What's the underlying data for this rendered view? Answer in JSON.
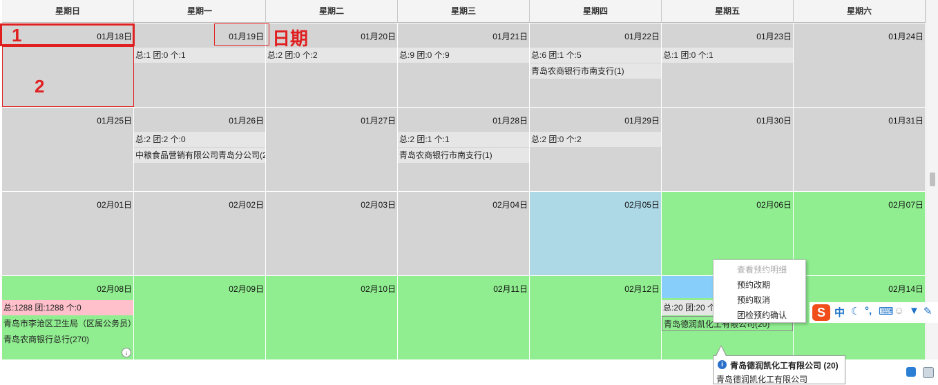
{
  "weekdays": [
    "星期日",
    "星期一",
    "星期二",
    "星期三",
    "星期四",
    "星期五",
    "星期六"
  ],
  "weeks": [
    [
      {
        "date": "01月18日",
        "color": "gray"
      },
      {
        "date": "01月19日",
        "color": "gray",
        "stat": "总:1 团:0 个:1"
      },
      {
        "date": "01月20日",
        "color": "gray",
        "stat": "总:2 团:0 个:2"
      },
      {
        "date": "01月21日",
        "color": "gray",
        "stat": "总:9 团:0 个:9"
      },
      {
        "date": "01月22日",
        "color": "gray",
        "stat": "总:6 团:1 个:5",
        "orgs": [
          "青岛农商银行市南支行(1)"
        ]
      },
      {
        "date": "01月23日",
        "color": "gray",
        "stat": "总:1 团:0 个:1"
      },
      {
        "date": "01月24日",
        "color": "gray"
      }
    ],
    [
      {
        "date": "01月25日",
        "color": "gray"
      },
      {
        "date": "01月26日",
        "color": "gray",
        "stat": "总:2 团:2 个:0",
        "orgs": [
          "中粮食品营销有限公司青岛分公司(2"
        ]
      },
      {
        "date": "01月27日",
        "color": "gray"
      },
      {
        "date": "01月28日",
        "color": "gray",
        "stat": "总:2 团:1 个:1",
        "orgs": [
          "青岛农商银行市南支行(1)"
        ]
      },
      {
        "date": "01月29日",
        "color": "gray",
        "stat": "总:2 团:0 个:2"
      },
      {
        "date": "01月30日",
        "color": "gray"
      },
      {
        "date": "01月31日",
        "color": "gray"
      }
    ],
    [
      {
        "date": "02月01日",
        "color": "gray"
      },
      {
        "date": "02月02日",
        "color": "gray"
      },
      {
        "date": "02月03日",
        "color": "gray"
      },
      {
        "date": "02月04日",
        "color": "gray"
      },
      {
        "date": "02月05日",
        "color": "blue"
      },
      {
        "date": "02月06日",
        "color": "green"
      },
      {
        "date": "02月07日",
        "color": "green"
      }
    ],
    [
      {
        "date": "02月08日",
        "color": "green",
        "stat": "总:1288 团:1288 个:0",
        "stat_pink": true,
        "orgs": [
          "青岛市李沧区卫生局（区属公务员）",
          "青岛农商银行总行(270)"
        ],
        "expand": "↓"
      },
      {
        "date": "02月09日",
        "color": "green"
      },
      {
        "date": "02月10日",
        "color": "green"
      },
      {
        "date": "02月11日",
        "color": "green"
      },
      {
        "date": "02月12日",
        "color": "green"
      },
      {
        "date": "",
        "color": "green",
        "stat": "总:20 团:20 个",
        "orgs": [
          "青岛德润凯化工有限公司(20)"
        ]
      },
      {
        "date": "02月14日",
        "color": "green"
      }
    ]
  ],
  "annotations": {
    "label1": "1",
    "label2": "2",
    "date_label": "日期"
  },
  "context_menu": [
    "查看预约明细",
    "预约改期",
    "预约取消",
    "团检预约确认"
  ],
  "ime_toolbar": {
    "logo": "S",
    "mode": "中"
  },
  "tooltip": {
    "icon": "i",
    "title": "青岛德润凯化工有限公司 (20)",
    "body": "青岛德润凯化工有限公司"
  },
  "colors": {
    "gray": "#d4d4d4",
    "green": "#90ee90",
    "blue": "#add8e6",
    "pink": "#ffc0cb",
    "annotation": "#e02020"
  }
}
